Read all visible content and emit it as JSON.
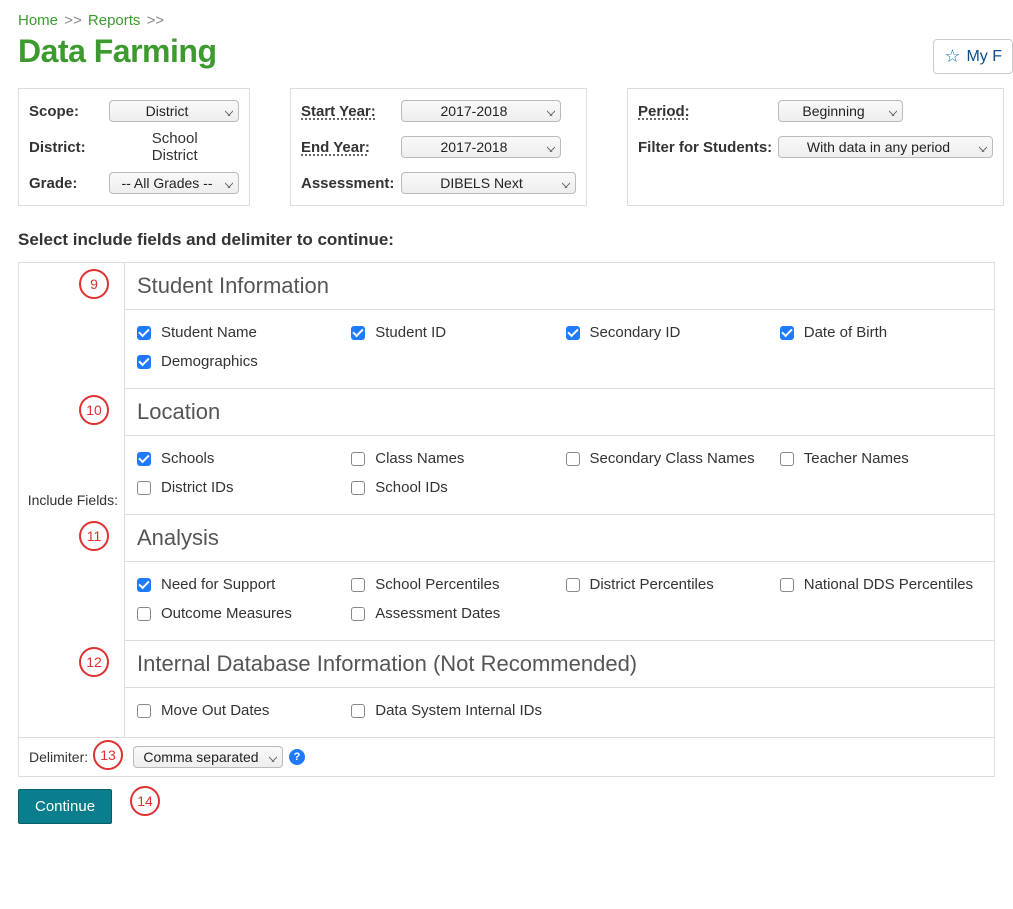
{
  "breadcrumb": {
    "home": "Home",
    "reports": "Reports",
    "sep": ">>"
  },
  "page_title": "Data Farming",
  "favorite_button": "My F",
  "filters": {
    "scope": {
      "label": "Scope:",
      "value": "District"
    },
    "district": {
      "label": "District:",
      "value": "School District"
    },
    "grade": {
      "label": "Grade:",
      "value": "-- All Grades --"
    },
    "start_year": {
      "label": "Start Year:",
      "value": "2017-2018"
    },
    "end_year": {
      "label": "End Year:",
      "value": "2017-2018"
    },
    "assessment": {
      "label": "Assessment:",
      "value": "DIBELS Next"
    },
    "period": {
      "label": "Period:",
      "value": "Beginning"
    },
    "filter_students": {
      "label": "Filter for Students:",
      "value": "With data in any period"
    }
  },
  "section_prompt": "Select include fields and delimiter to continue:",
  "include_fields_label": "Include Fields:",
  "delimiter": {
    "label": "Delimiter:",
    "value": "Comma separated"
  },
  "continue_label": "Continue",
  "callouts": {
    "g1": "9",
    "g2": "10",
    "g3": "11",
    "g4": "12",
    "delim": "13",
    "cont": "14"
  },
  "groups": [
    {
      "title": "Student Information",
      "items": [
        {
          "label": "Student Name",
          "checked": true
        },
        {
          "label": "Student ID",
          "checked": true
        },
        {
          "label": "Secondary ID",
          "checked": true
        },
        {
          "label": "Date of Birth",
          "checked": true
        },
        {
          "label": "Demographics",
          "checked": true
        }
      ]
    },
    {
      "title": "Location",
      "items": [
        {
          "label": "Schools",
          "checked": true
        },
        {
          "label": "Class Names",
          "checked": false
        },
        {
          "label": "Secondary Class Names",
          "checked": false
        },
        {
          "label": "Teacher Names",
          "checked": false
        },
        {
          "label": "District IDs",
          "checked": false
        },
        {
          "label": "School IDs",
          "checked": false
        }
      ]
    },
    {
      "title": "Analysis",
      "items": [
        {
          "label": "Need for Support",
          "checked": true
        },
        {
          "label": "School Percentiles",
          "checked": false
        },
        {
          "label": "District Percentiles",
          "checked": false
        },
        {
          "label": "National DDS Percentiles",
          "checked": false
        },
        {
          "label": "Outcome Measures",
          "checked": false
        },
        {
          "label": "Assessment Dates",
          "checked": false
        }
      ]
    },
    {
      "title": "Internal Database Information (Not Recommended)",
      "items": [
        {
          "label": "Move Out Dates",
          "checked": false
        },
        {
          "label": "Data System Internal IDs",
          "checked": false
        }
      ]
    }
  ]
}
